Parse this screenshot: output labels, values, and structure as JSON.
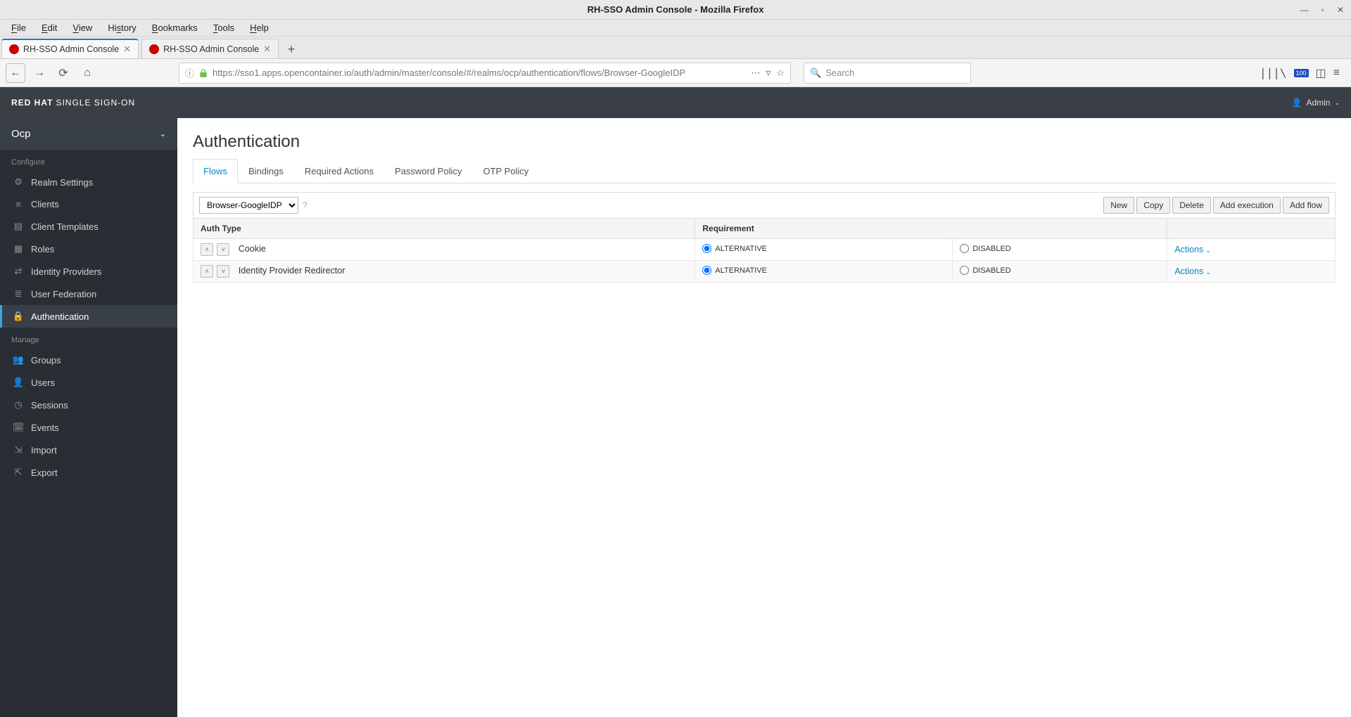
{
  "window": {
    "title": "RH-SSO Admin Console - Mozilla Firefox"
  },
  "menubar": {
    "file": "File",
    "edit": "Edit",
    "view": "View",
    "history": "History",
    "bookmarks": "Bookmarks",
    "tools": "Tools",
    "help": "Help"
  },
  "tabs_browser": {
    "tab1": "RH-SSO Admin Console",
    "tab2": "RH-SSO Admin Console"
  },
  "urlbar": {
    "url": "https://sso1.apps.opencontainer.io/auth/admin/master/console/#/realms/ocp/authentication/flows/Browser-GoogleIDP"
  },
  "search": {
    "placeholder": "Search"
  },
  "badge100": "100",
  "brand": {
    "bold": "RED HAT",
    "light": "SINGLE SIGN-ON"
  },
  "user": {
    "label": "Admin"
  },
  "realm": {
    "name": "Ocp"
  },
  "side_labels": {
    "configure": "Configure",
    "manage": "Manage"
  },
  "sidebar": {
    "realm_settings": "Realm Settings",
    "clients": "Clients",
    "client_templates": "Client Templates",
    "roles": "Roles",
    "identity_providers": "Identity Providers",
    "user_federation": "User Federation",
    "authentication": "Authentication",
    "groups": "Groups",
    "users": "Users",
    "sessions": "Sessions",
    "events": "Events",
    "import": "Import",
    "export": "Export"
  },
  "page": {
    "title": "Authentication"
  },
  "ptabs": {
    "flows": "Flows",
    "bindings": "Bindings",
    "required_actions": "Required Actions",
    "password_policy": "Password Policy",
    "otp_policy": "OTP Policy"
  },
  "flow_select": "Browser-GoogleIDP",
  "toolbar": {
    "new": "New",
    "copy": "Copy",
    "del": "Delete",
    "add_execution": "Add execution",
    "add_flow": "Add flow"
  },
  "table": {
    "h_auth_type": "Auth Type",
    "h_requirement": "Requirement",
    "r1": {
      "name": "Cookie",
      "opt_alt": "ALTERNATIVE",
      "opt_dis": "DISABLED",
      "actions": "Actions"
    },
    "r2": {
      "name": "Identity Provider Redirector",
      "opt_alt": "ALTERNATIVE",
      "opt_dis": "DISABLED",
      "actions": "Actions"
    }
  }
}
